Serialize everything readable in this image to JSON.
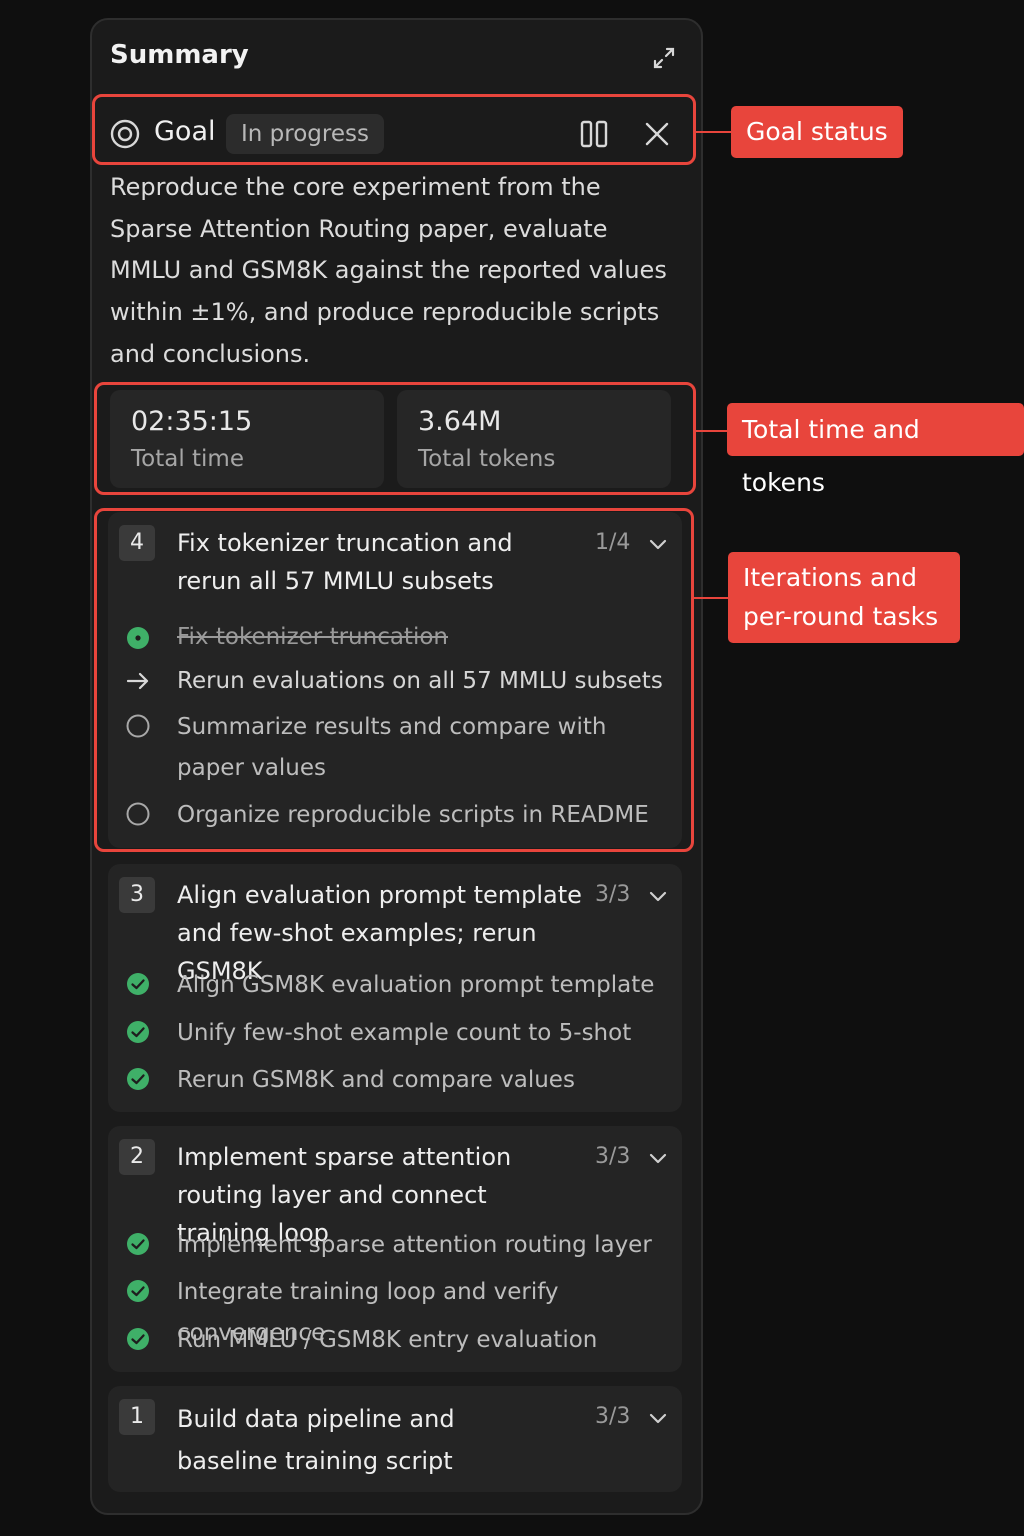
{
  "panel": {
    "title": "Summary"
  },
  "goal": {
    "label": "Goal",
    "status": "In progress",
    "description": "Reproduce the core experiment from the Sparse Attention Routing paper, evaluate MMLU and GSM8K against the reported values within ±1%, and produce reproducible scripts and conclusions."
  },
  "stats": [
    {
      "value": "02:35:15",
      "label": "Total time"
    },
    {
      "value": "3.64M",
      "label": "Total tokens"
    }
  ],
  "iterations": [
    {
      "number": "4",
      "title": "Fix tokenizer truncation and rerun all 57 MMLU subsets",
      "progress": "1/4",
      "tasks": [
        {
          "text": "Fix tokenizer truncation",
          "state": "done"
        },
        {
          "text": "Rerun evaluations on all 57 MMLU subsets",
          "state": "current"
        },
        {
          "text": "Summarize results and compare with paper values",
          "state": "pending"
        },
        {
          "text": "Organize reproducible scripts in README",
          "state": "pending"
        }
      ]
    },
    {
      "number": "3",
      "title": "Align evaluation prompt template and few-shot examples; rerun GSM8K",
      "progress": "3/3",
      "tasks": [
        {
          "text": "Align GSM8K evaluation prompt template",
          "state": "complete"
        },
        {
          "text": "Unify few-shot example count to 5-shot",
          "state": "complete"
        },
        {
          "text": "Rerun GSM8K and compare values",
          "state": "complete"
        }
      ]
    },
    {
      "number": "2",
      "title": "Implement sparse attention routing layer and connect training loop",
      "progress": "3/3",
      "tasks": [
        {
          "text": "Implement sparse attention routing layer",
          "state": "complete"
        },
        {
          "text": "Integrate training loop and verify convergence",
          "state": "complete"
        },
        {
          "text": "Run MMLU / GSM8K entry evaluation",
          "state": "complete"
        }
      ]
    },
    {
      "number": "1",
      "title": "Build data pipeline and baseline training script",
      "progress": "3/3",
      "tasks": []
    }
  ],
  "callouts": {
    "goal_status": "Goal status",
    "time_tokens": "Total time and tokens",
    "iterations": "Iterations and per-round tasks"
  },
  "colors": {
    "accent_red": "#e8453c",
    "success_green": "#3fb068",
    "panel_bg": "#1b1b1b",
    "card_bg": "#242424"
  },
  "icons": [
    "expand-icon",
    "target-icon",
    "pause-icon",
    "close-icon",
    "chevron-down-icon",
    "check-circle-icon",
    "arrow-right-icon",
    "empty-circle-icon"
  ]
}
